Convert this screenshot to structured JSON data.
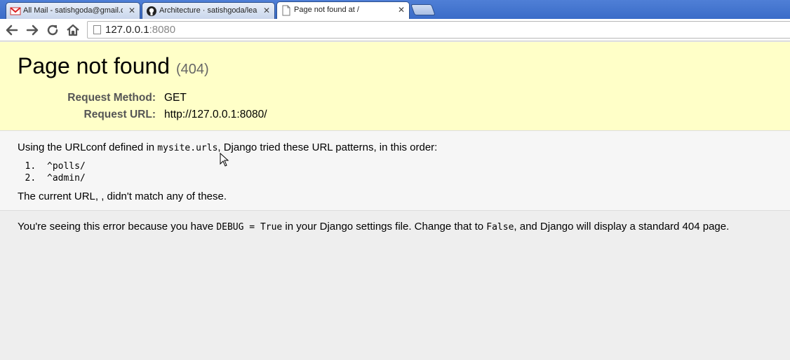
{
  "browser": {
    "tabs": [
      {
        "title": "All Mail - satishgoda@gmail.c",
        "icon": "gmail-icon",
        "active": false
      },
      {
        "title": "Architecture · satishgoda/lea",
        "icon": "github-icon",
        "active": false
      },
      {
        "title": "Page not found at /",
        "icon": "page-icon",
        "active": true
      }
    ],
    "close_glyph": "✕",
    "address": {
      "host": "127.0.0.1",
      "port": ":8080"
    }
  },
  "summary": {
    "heading": "Page not found",
    "code": "(404)",
    "request_method_label": "Request Method:",
    "request_method": "GET",
    "request_url_label": "Request URL:",
    "request_url": "http://127.0.0.1:8080/"
  },
  "info": {
    "intro_before": "Using the URLconf defined in ",
    "urlconf": "mysite.urls",
    "intro_after": ", Django tried these URL patterns, in this order:",
    "patterns": [
      "^polls/",
      "^admin/"
    ],
    "current_url_text": "The current URL, , didn't match any of these."
  },
  "explanation": {
    "before": "You're seeing this error because you have ",
    "debug": "DEBUG = True",
    "middle": " in your Django settings file. Change that to ",
    "false": "False",
    "after": ", and Django will display a standard 404 page."
  },
  "colors": {
    "summary_bg": "#ffffc8",
    "info_bg": "#f6f6f6",
    "explanation_bg": "#eeeeee",
    "tabstrip": "#3a6cc8"
  }
}
